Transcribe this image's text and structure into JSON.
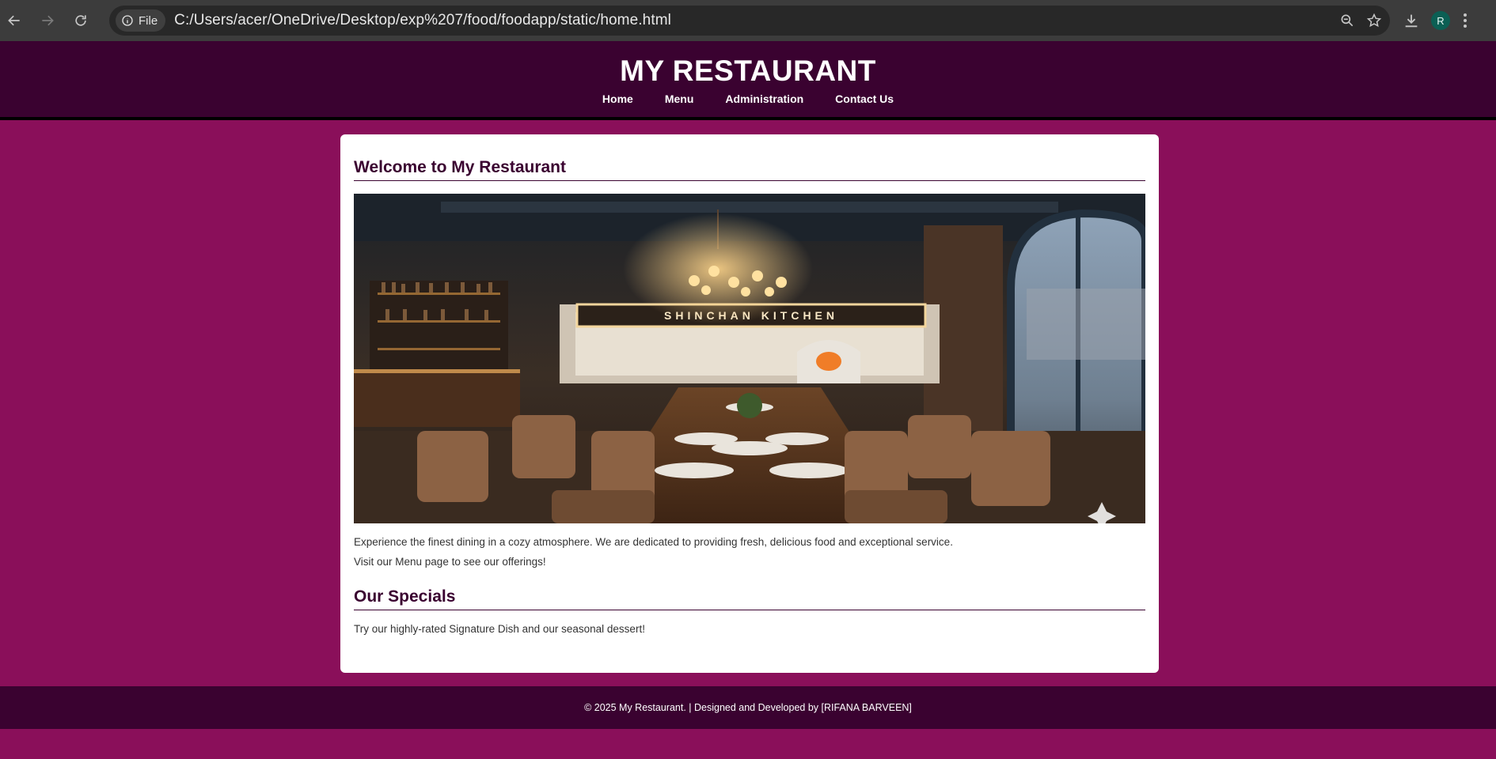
{
  "browser": {
    "url": "C:/Users/acer/OneDrive/Desktop/exp%207/food/foodapp/static/home.html",
    "site_chip_label": "File",
    "profile_initial": "R",
    "icons": [
      "back-icon",
      "forward-icon",
      "reload-icon",
      "info-icon",
      "zoom-icon",
      "star-icon",
      "download-icon",
      "menu-icon"
    ]
  },
  "header": {
    "title": "MY RESTAURANT",
    "nav": [
      "Home",
      "Menu",
      "Administration",
      "Contact Us"
    ]
  },
  "main": {
    "welcome_heading": "Welcome to My Restaurant",
    "hero_sign": "SHINCHAN KITCHEN",
    "intro": "Experience the finest dining in a cozy atmosphere. We are dedicated to providing fresh, delicious food and exceptional service.",
    "menu_prompt": "Visit our Menu page to see our offerings!",
    "specials_heading": "Our Specials",
    "specials_text": "Try our highly-rated Signature Dish and our seasonal dessert!"
  },
  "footer": {
    "text": "© 2025 My Restaurant. | Designed and Developed by [RIFANA BARVEEN]"
  },
  "colors": {
    "page_background": "#8a0f5a",
    "header_background": "#3a0230",
    "card_background": "#ffffff",
    "heading": "#3a0230"
  }
}
